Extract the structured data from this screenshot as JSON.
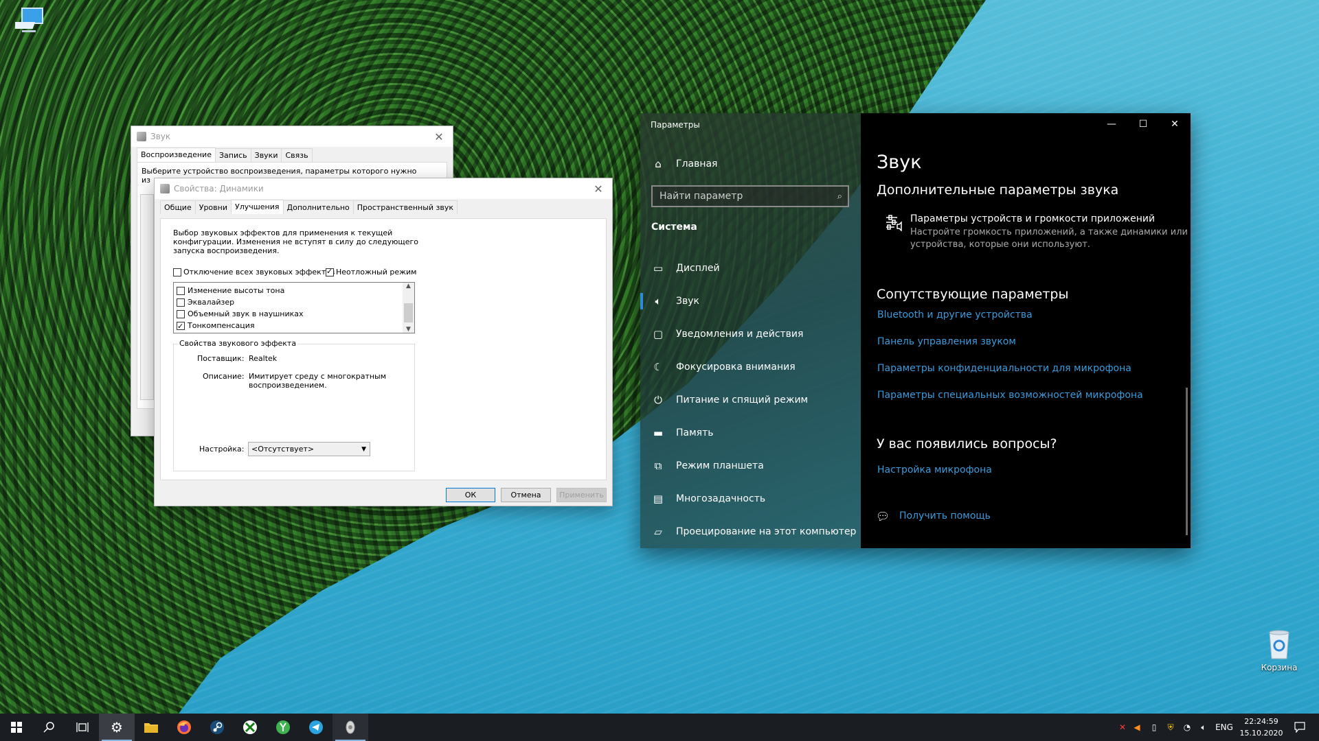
{
  "desktop": {
    "icons": [
      {
        "label": "",
        "icon": "this-pc-icon"
      },
      {
        "label": "Корзина",
        "icon": "recycle-bin-icon"
      }
    ]
  },
  "sound_window": {
    "title": "Звук",
    "tabs": [
      "Воспроизведение",
      "Запись",
      "Звуки",
      "Связь"
    ],
    "active_tab": "Воспроизведение",
    "description_line1": "Выберите устройство воспроизведения, параметры которого нужно",
    "description_line2": "из"
  },
  "props_window": {
    "title": "Свойства: Динамики",
    "tabs": [
      "Общие",
      "Уровни",
      "Улучшения",
      "Дополнительно",
      "Пространственный звук"
    ],
    "active_tab": "Улучшения",
    "intro_line1": "Выбор звуковых эффектов для применения к текущей",
    "intro_line2": "конфигурации. Изменения не вступят в силу до следующего",
    "intro_line3": "запуска воспроизведения.",
    "disable_all_label": "Отключение всех звуковых эффектов",
    "disable_all_checked": false,
    "immediate_label": "Неотложный режим",
    "immediate_checked": true,
    "effects": [
      {
        "label": "Изменение высоты тона",
        "checked": false
      },
      {
        "label": "Эквалайзер",
        "checked": false
      },
      {
        "label": "Объемный звук в наушниках",
        "checked": false
      },
      {
        "label": "Тонкомпенсация",
        "checked": true
      }
    ],
    "group_title": "Свойства звукового эффекта",
    "provider_label": "Поставщик:",
    "provider_value": "Realtek",
    "desc_label": "Описание:",
    "desc_value_line1": "Имитирует среду с многократным",
    "desc_value_line2": "воспроизведением.",
    "setting_label": "Настройка:",
    "setting_value": "<Отсутствует>",
    "ok": "ОК",
    "cancel": "Отмена",
    "apply": "Применить"
  },
  "settings": {
    "app_title": "Параметры",
    "home": "Главная",
    "search_placeholder": "Найти параметр",
    "section": "Система",
    "nav": [
      {
        "label": "Дисплей",
        "icon": "display-icon",
        "active": false
      },
      {
        "label": "Звук",
        "icon": "speaker-icon",
        "active": true
      },
      {
        "label": "Уведомления и действия",
        "icon": "notification-icon",
        "active": false
      },
      {
        "label": "Фокусировка внимания",
        "icon": "moon-icon",
        "active": false
      },
      {
        "label": "Питание и спящий режим",
        "icon": "power-icon",
        "active": false
      },
      {
        "label": "Память",
        "icon": "storage-icon",
        "active": false
      },
      {
        "label": "Режим планшета",
        "icon": "tablet-icon",
        "active": false
      },
      {
        "label": "Многозадачность",
        "icon": "multitasking-icon",
        "active": false
      },
      {
        "label": "Проецирование на этот компьютер",
        "icon": "projecting-icon",
        "active": false
      }
    ],
    "page_title": "Звук",
    "subtitle": "Дополнительные параметры звука",
    "device_title": "Параметры устройств и громкости приложений",
    "device_desc_line1": "Настройте громкость приложений, а также динамики или",
    "device_desc_line2": "устройства, которые они используют.",
    "related_title": "Сопутствующие параметры",
    "related_links": [
      "Bluetooth и другие устройства",
      "Панель управления звуком",
      "Параметры конфиденциальности для микрофона",
      "Параметры специальных возможностей микрофона"
    ],
    "questions_title": "У вас появились вопросы?",
    "questions_link": "Настройка микрофона",
    "help_link": "Получить помощь"
  },
  "taskbar": {
    "pinned": [
      "start-icon",
      "search-icon",
      "task-view-icon",
      "settings-icon",
      "file-explorer-icon",
      "firefox-icon",
      "steam-icon",
      "xbox-icon",
      "green-app-icon",
      "telegram-icon",
      "sound-app-icon"
    ],
    "lang": "ENG",
    "time": "22:24:59",
    "date": "15.10.2020"
  }
}
